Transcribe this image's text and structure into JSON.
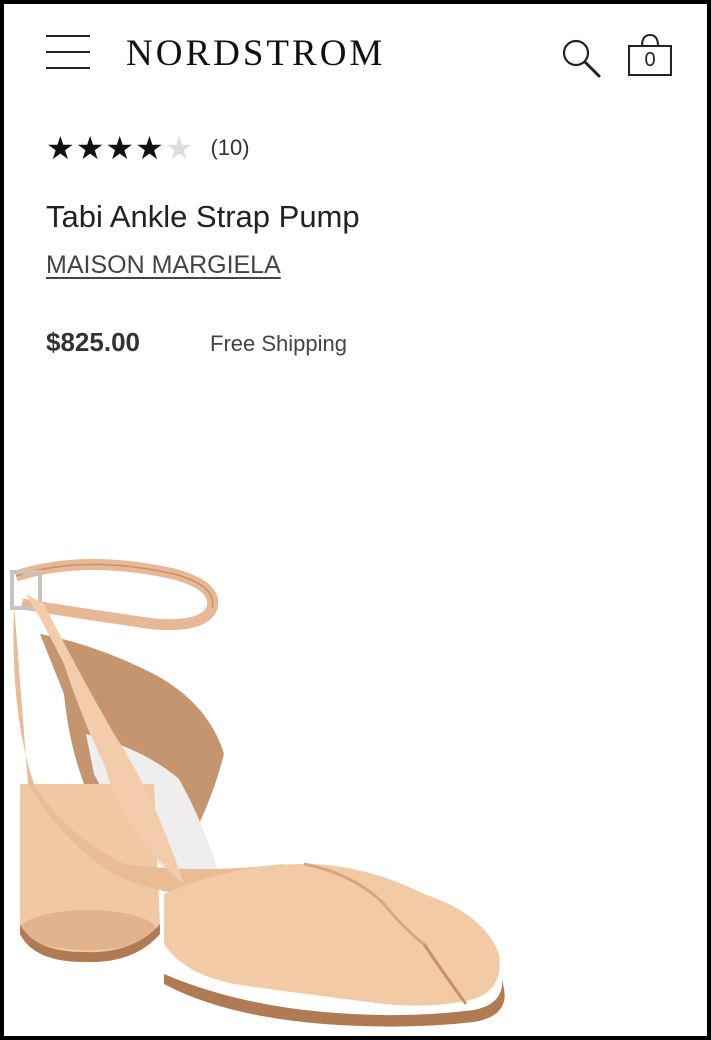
{
  "header": {
    "logo": "NORDSTROM",
    "menu_icon": "hamburger-menu-icon",
    "search_icon": "search-icon",
    "bag_icon": "shopping-bag-icon",
    "bag_count": "0"
  },
  "product": {
    "rating": {
      "full_stars": "★★★★",
      "empty_stars": "★",
      "value": 4.5,
      "max": 5,
      "review_count": "(10)"
    },
    "title": "Tabi Ankle Strap Pump",
    "brand": "MAISON MARGIELA",
    "price": "$825.00",
    "shipping": "Free Shipping",
    "image_icon": "shoe-image",
    "colors": {
      "leather": "#f0c8a4",
      "leather_shadow": "#d9a57f",
      "sole": "#b07a52",
      "lining": "#eeeeee"
    }
  }
}
